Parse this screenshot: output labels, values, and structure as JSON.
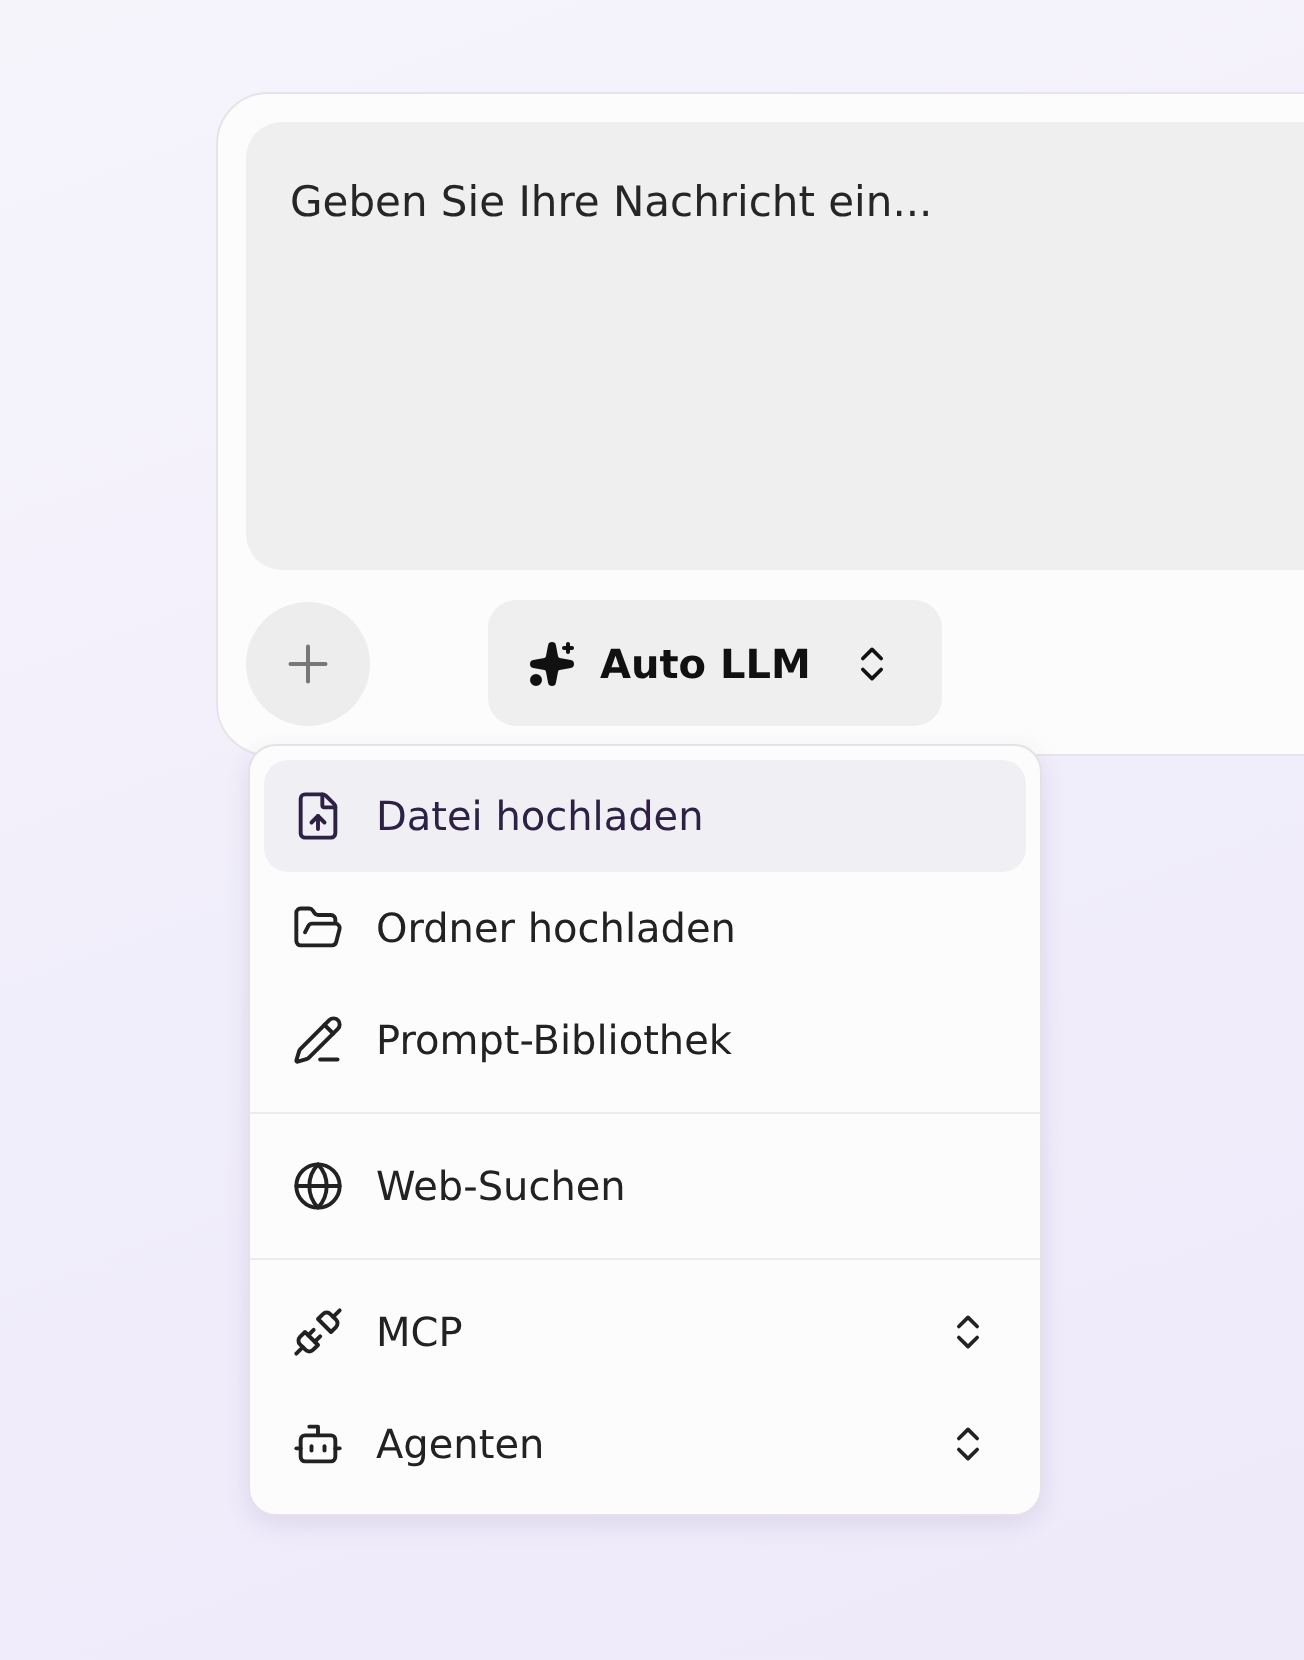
{
  "composer": {
    "placeholder": "Geben Sie Ihre Nachricht ein...",
    "model_button": {
      "label": "Auto LLM"
    }
  },
  "menu": {
    "sections": [
      [
        {
          "label": "Datei hochladen",
          "selected": true,
          "kind": "action"
        },
        {
          "label": "Ordner hochladen",
          "selected": false,
          "kind": "action"
        },
        {
          "label": "Prompt-Bibliothek",
          "selected": false,
          "kind": "action"
        }
      ],
      [
        {
          "label": "Web-Suchen",
          "selected": false,
          "kind": "action"
        }
      ],
      [
        {
          "label": "MCP",
          "selected": false,
          "kind": "submenu"
        },
        {
          "label": "Agenten",
          "selected": false,
          "kind": "submenu"
        }
      ]
    ]
  }
}
